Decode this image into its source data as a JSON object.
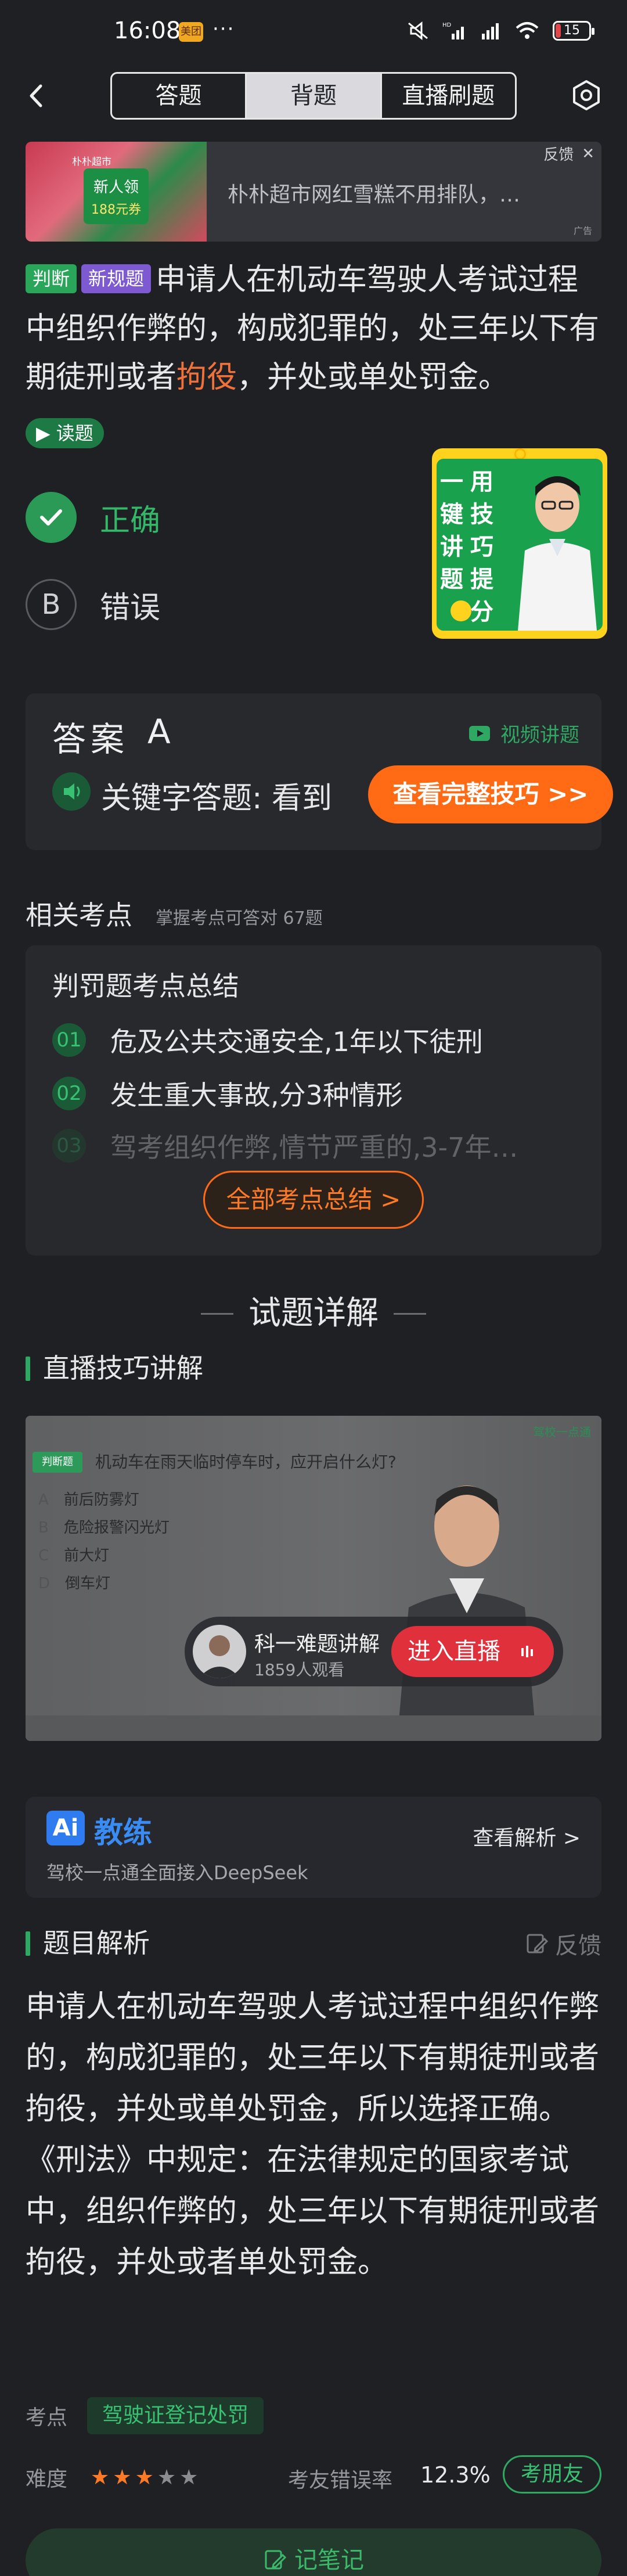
{
  "status_bar": {
    "time": "16:08",
    "badge": "美团",
    "dots": "···",
    "network": "HD",
    "battery": "15"
  },
  "nav": {
    "tabs": [
      "答题",
      "背题",
      "直播刷题"
    ],
    "active_tab": "背题"
  },
  "ad_banner": {
    "logo": "朴朴超市",
    "card_title": "新人领",
    "card_sub": "188元券",
    "text": "朴朴超市网红雪糕不用排队，…",
    "feedback": "反馈",
    "mark": "广告"
  },
  "question": {
    "tag_type": "判断",
    "tag_rule": "新规题",
    "text_before": "申请人在机动车驾驶人考试过程中组织作弊的，构成犯罪的，处三年以下有期徒刑或者",
    "highlight": "拘役",
    "text_after": "，并处或单处罚金。",
    "read_label": "▶ 读题"
  },
  "options": [
    {
      "mark": "✓",
      "label": "正确"
    },
    {
      "mark": "B",
      "label": "错误"
    }
  ],
  "float_ad": {
    "col1": [
      "一",
      "键",
      "讲",
      "题"
    ],
    "col2": [
      "用",
      "技",
      "巧",
      "提",
      "分"
    ]
  },
  "answer": {
    "label": "答案",
    "letter": "A",
    "video_link": "视频讲题",
    "keyword_text": "关键字答题: 看到",
    "tip_button": "查看完整技巧 >>"
  },
  "points": {
    "section_title": "相关考点",
    "section_sub": "掌握考点可答对 67题",
    "card_title": "判罚题考点总结",
    "items": [
      {
        "num": "01",
        "text": "危及公共交通安全,1年以下徒刑"
      },
      {
        "num": "02",
        "text": "发生重大事故,分3种情形"
      },
      {
        "num": "03",
        "text": "驾考组织作弊,情节严重的,3-7年…"
      }
    ],
    "all_button": "全部考点总结 >"
  },
  "detail": {
    "heading": "试题详解",
    "live_section": "直播技巧讲解",
    "video": {
      "tag": "判断题",
      "logo": "驾校一点通",
      "question": "机动车在雨天临时停车时，应开启什么灯?",
      "options": [
        {
          "letter": "A",
          "text": "前后防雾灯"
        },
        {
          "letter": "B",
          "text": "危险报警闪光灯"
        },
        {
          "letter": "C",
          "text": "前大灯"
        },
        {
          "letter": "D",
          "text": "倒车灯"
        }
      ]
    },
    "live": {
      "name": "科一难题讲解",
      "count": "1859人观看",
      "button": "进入直播"
    }
  },
  "coach": {
    "logo": "Ai",
    "name": "教练",
    "sub": "驾校一点通全面接入DeepSeek",
    "link": "查看解析 >"
  },
  "analysis": {
    "title": "题目解析",
    "feedback": "反馈",
    "para1": "申请人在机动车驾驶人考试过程中组织作弊的，构成犯罪的，处三年以下有期徒刑或者拘役，并处或单处罚金，所以选择正确。",
    "para2": "《刑法》中规定：在法律规定的国家考试中，组织作弊的，处三年以下有期徒刑或者拘役，并处或者单处罚金。"
  },
  "meta": {
    "kp_label": "考点",
    "kp_tag": "驾驶证登记处罚",
    "difficulty_label": "难度",
    "difficulty_stars": 3,
    "difficulty_max": 5,
    "err_label": "考友错误率",
    "err_value": "12.3%",
    "friend_button": "考朋友"
  },
  "note_button": "记笔记",
  "colors": {
    "accent_green": "#2ea862",
    "accent_orange": "#ff6a14",
    "background": "#1f2023"
  }
}
